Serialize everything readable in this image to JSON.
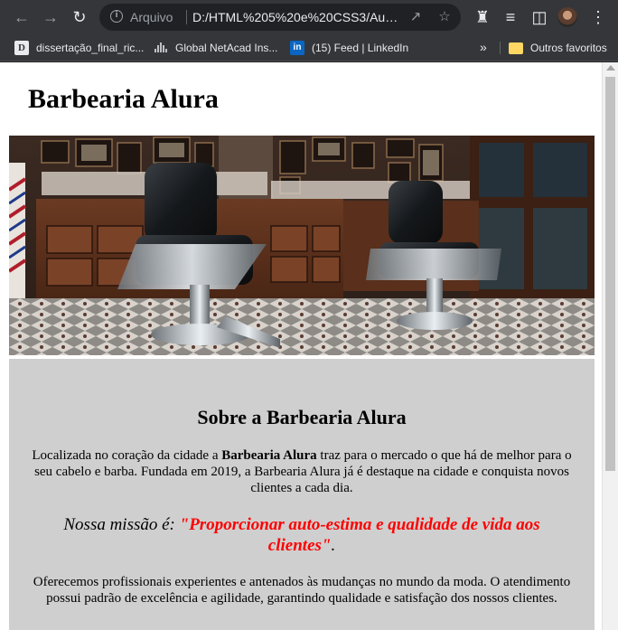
{
  "browser": {
    "omnibox": {
      "scheme_label": "Arquivo",
      "url": "D:/HTML%205%20e%20CSS3/Aula..."
    },
    "bookmarks": [
      {
        "label": "dissertação_final_ric...",
        "icon": "d-favicon-icon"
      },
      {
        "label": "Global NetAcad Ins...",
        "icon": "cisco-icon"
      },
      {
        "label": "(15) Feed | LinkedIn",
        "icon": "linkedin-icon"
      }
    ],
    "bookmarks_more": "»",
    "other_favorites": "Outros favoritos"
  },
  "page": {
    "title": "Barbearia Alura",
    "about": {
      "heading": "Sobre a Barbearia Alura",
      "p1_before": "Localizada no coração da cidade a ",
      "p1_bold": "Barbearia Alura",
      "p1_after": " traz para o mercado o que há de melhor para o seu cabelo e barba. Fundada em 2019, a Barbearia Alura já é destaque na cidade e conquista novos clientes a cada dia.",
      "mission_lead": "Nossa missão é: ",
      "mission_quote": "\"Proporcionar auto-estima e qualidade de vida aos clientes\"",
      "mission_end": ".",
      "p3": "Oferecemos profissionais experientes e antenados às mudanças no mundo da moda. O atendimento possui padrão de excelência e agilidade, garantindo qualidade e satisfação dos nossos clientes."
    }
  },
  "colors": {
    "mission_highlight": "#ff0000",
    "about_background": "#cfcfcf",
    "chrome": "#35363a"
  }
}
